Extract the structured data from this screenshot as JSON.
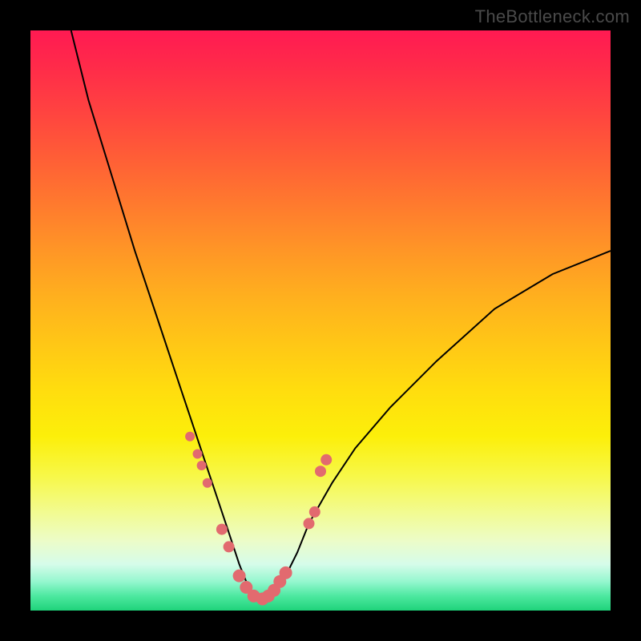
{
  "watermark": "TheBottleneck.com",
  "colors": {
    "background": "#000000",
    "gradient_top": "#ff1a52",
    "gradient_mid": "#ffdd0e",
    "gradient_bottom": "#1fd37a",
    "curve": "#000000",
    "dots": "#e26a6f"
  },
  "chart_data": {
    "type": "line",
    "title": "",
    "xlabel": "",
    "ylabel": "",
    "xlim": [
      0,
      100
    ],
    "ylim": [
      0,
      100
    ],
    "note": "No axis ticks or labels visible; values estimated from pixel positions. y=0 at bottom of gradient, y=100 at top. Curve is a steep V with minimum near x≈38, y≈2.",
    "series": [
      {
        "name": "bottleneck-curve",
        "x": [
          7,
          10,
          14,
          18,
          22,
          26,
          28,
          30,
          32,
          34,
          36,
          38,
          40,
          42,
          44,
          46,
          48,
          52,
          56,
          62,
          70,
          80,
          90,
          100
        ],
        "y": [
          100,
          88,
          75,
          62,
          50,
          38,
          32,
          26,
          20,
          14,
          8,
          3,
          2,
          3,
          6,
          10,
          15,
          22,
          28,
          35,
          43,
          52,
          58,
          62
        ]
      }
    ],
    "scatter": [
      {
        "name": "highlight-dots",
        "x": [
          27.5,
          28.8,
          29.5,
          30.5,
          33.0,
          34.2,
          36.0,
          37.2,
          38.5,
          40.0,
          41.0,
          42.0,
          43.0,
          44.0,
          48.0,
          49.0,
          50.0,
          51.0
        ],
        "y": [
          30,
          27,
          25,
          22,
          14,
          11,
          6,
          4,
          2.5,
          2,
          2.5,
          3.5,
          5,
          6.5,
          15,
          17,
          24,
          26
        ],
        "r": [
          6,
          6,
          6,
          6,
          7,
          7,
          8,
          8,
          8,
          8,
          8,
          8,
          8,
          8,
          7,
          7,
          7,
          7
        ]
      }
    ]
  }
}
